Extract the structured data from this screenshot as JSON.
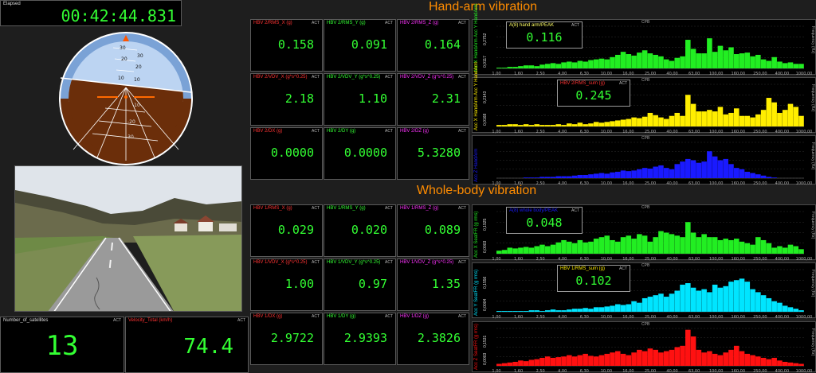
{
  "elapsed": {
    "label": "Elapsed",
    "value": "00:42:44.831"
  },
  "horizon": {
    "pitch_labels": [
      "30",
      "20",
      "10",
      "-10",
      "-20",
      "-30",
      "30",
      "20",
      "10"
    ]
  },
  "satellites": {
    "label": "Number_of_satellites",
    "act": "ACT",
    "value": "13"
  },
  "velocity": {
    "label": "Velocity_Total (km/h)",
    "act": "ACT",
    "value": "74.4"
  },
  "hand_arm": {
    "title": "Hand-arm vibration",
    "cells": [
      {
        "label": "HBV 2/RMS_X (g)",
        "act": "ACT",
        "value": "0.158",
        "color": "#ff3333"
      },
      {
        "label": "HBV 2/RMS_Y (g)",
        "act": "ACT",
        "value": "0.091",
        "color": "#33ff33"
      },
      {
        "label": "HBV 2/RMS_Z (g)",
        "act": "ACT",
        "value": "0.164",
        "color": "#ff33ff"
      },
      {
        "label": "HBV 2/VDV_X (g*s^0.25)",
        "act": "ACT",
        "value": "2.18",
        "color": "#ff3333"
      },
      {
        "label": "HBV 2/VDV_Y (g*s^0.25)",
        "act": "ACT",
        "value": "1.10",
        "color": "#33ff33"
      },
      {
        "label": "HBV 2/VDV_Z (g*s^0.25)",
        "act": "ACT",
        "value": "2.31",
        "color": "#ff33ff"
      },
      {
        "label": "HBV 2/DX (g)",
        "act": "ACT",
        "value": "0.0000",
        "color": "#ff3333"
      },
      {
        "label": "HBV 2/DY (g)",
        "act": "ACT",
        "value": "0.0000",
        "color": "#33ff33"
      },
      {
        "label": "HBV 2/DZ (g)",
        "act": "ACT",
        "value": "5.3280",
        "color": "#ff33ff"
      }
    ]
  },
  "whole_body": {
    "title": "Whole-body vibration",
    "cells": [
      {
        "label": "HBV 1/RMS_X (g)",
        "act": "ACT",
        "value": "0.029",
        "color": "#ff3333"
      },
      {
        "label": "HBV 1/RMS_Y (g)",
        "act": "ACT",
        "value": "0.020",
        "color": "#33ff33"
      },
      {
        "label": "HBV 1/RMS_Z (g)",
        "act": "ACT",
        "value": "0.089",
        "color": "#ff33ff"
      },
      {
        "label": "HBV 1/VDV_X (g*s^0.25)",
        "act": "ACT",
        "value": "1.00",
        "color": "#ff3333"
      },
      {
        "label": "HBV 1/VDV_Y (g*s^0.25)",
        "act": "ACT",
        "value": "0.97",
        "color": "#33ff33"
      },
      {
        "label": "HBV 1/VDV_Z (g*s^0.25)",
        "act": "ACT",
        "value": "1.35",
        "color": "#ff33ff"
      },
      {
        "label": "HBV 1/DX (g)",
        "act": "ACT",
        "value": "2.9722",
        "color": "#ff3333"
      },
      {
        "label": "HBV 1/DY (g)",
        "act": "ACT",
        "value": "2.9393",
        "color": "#33ff33"
      },
      {
        "label": "HBV 1/DZ (g)",
        "act": "ACT",
        "value": "2.3826",
        "color": "#ff33ff"
      }
    ]
  },
  "spectra_common": {
    "cpb_label": "CPB",
    "freq_label": "Frequency (Hz)",
    "ticks": [
      "1,00",
      "1,60",
      "2,50",
      "4,00",
      "6,30",
      "10,00",
      "16,00",
      "25,00",
      "40,00",
      "63,00",
      "100,00",
      "160,00",
      "250,00",
      "400,00",
      "1000,00"
    ]
  },
  "chart_data": [
    {
      "type": "bar",
      "ylabel": "Acc X HandArm Acc Y HandArm",
      "ylim_labels": [
        "0,2752",
        "0,0117"
      ],
      "overlay_label": "A(8) hand arm/PEAK",
      "overlay_value": "0.116",
      "overlay_label_color": "#ffff66",
      "color": "#22ee22",
      "values": [
        1,
        1,
        2,
        2,
        3,
        4,
        4,
        3,
        5,
        6,
        7,
        6,
        8,
        9,
        8,
        10,
        9,
        11,
        12,
        13,
        12,
        15,
        18,
        22,
        19,
        17,
        21,
        24,
        20,
        18,
        16,
        12,
        10,
        14,
        16,
        38,
        26,
        20,
        20,
        40,
        22,
        30,
        24,
        28,
        19,
        20,
        21,
        16,
        18,
        12,
        10,
        15,
        9,
        7,
        8,
        6,
        6
      ]
    },
    {
      "type": "bar",
      "ylabel": "Acc X HandArm Acc Y HandArm",
      "ylim_labels": [
        "0,2143",
        "0,0168"
      ],
      "overlay_label": "HBV 2/RMS_sum (g)",
      "overlay_value": "0.245",
      "overlay_label_color": "#ff3333",
      "color": "#ffee00",
      "values": [
        2,
        2,
        3,
        3,
        2,
        3,
        2,
        3,
        2,
        2,
        2,
        3,
        2,
        4,
        3,
        5,
        3,
        4,
        6,
        5,
        6,
        7,
        8,
        9,
        10,
        12,
        11,
        13,
        18,
        15,
        12,
        10,
        14,
        18,
        14,
        42,
        30,
        20,
        20,
        22,
        20,
        26,
        16,
        18,
        24,
        14,
        14,
        12,
        16,
        22,
        38,
        32,
        18,
        22,
        30,
        26,
        14
      ]
    },
    {
      "type": "bar",
      "ylabel": "Acc Z HandArm",
      "ylim_labels": [],
      "overlay_label": "",
      "overlay_value": "",
      "overlay_label_color": "#ffffff",
      "color": "#1a1aff",
      "values": [
        0,
        0,
        0,
        0,
        0,
        1,
        1,
        1,
        2,
        2,
        2,
        3,
        3,
        3,
        4,
        5,
        5,
        6,
        7,
        8,
        7,
        9,
        10,
        12,
        11,
        12,
        14,
        16,
        15,
        18,
        20,
        16,
        14,
        22,
        26,
        30,
        28,
        24,
        26,
        42,
        34,
        28,
        30,
        22,
        16,
        14,
        10,
        8,
        6,
        4,
        2,
        1,
        0,
        0,
        0,
        0,
        0
      ]
    },
    {
      "type": "bar",
      "ylabel": "Acc X SeatFR (g rms)",
      "ylim_labels": [
        "0,1925",
        "0,0003"
      ],
      "overlay_label": "A(8) whole body/PEAK",
      "overlay_value": "0.048",
      "overlay_label_color": "#1a1aff",
      "color": "#22ee22",
      "values": [
        4,
        5,
        8,
        7,
        8,
        9,
        8,
        10,
        12,
        10,
        12,
        15,
        18,
        16,
        14,
        18,
        15,
        16,
        20,
        22,
        24,
        18,
        16,
        22,
        24,
        20,
        26,
        24,
        16,
        22,
        30,
        28,
        26,
        24,
        22,
        42,
        28,
        22,
        26,
        22,
        22,
        18,
        20,
        18,
        20,
        16,
        14,
        12,
        22,
        18,
        14,
        8,
        10,
        8,
        12,
        10,
        6
      ]
    },
    {
      "type": "bar",
      "ylabel": "Acc Y SeatFR (g rms)",
      "ylim_labels": [
        "0,1556",
        "0,0004"
      ],
      "overlay_label": "HBV 1/RMS_sum (g)",
      "overlay_value": "0.102",
      "overlay_label_color": "#ffee00",
      "color": "#00e5ff",
      "values": [
        1,
        1,
        1,
        1,
        1,
        1,
        2,
        2,
        1,
        2,
        3,
        2,
        2,
        3,
        4,
        4,
        5,
        4,
        6,
        6,
        7,
        8,
        10,
        9,
        10,
        14,
        12,
        18,
        20,
        22,
        24,
        20,
        24,
        28,
        36,
        38,
        32,
        28,
        30,
        26,
        36,
        32,
        34,
        40,
        42,
        44,
        40,
        30,
        26,
        22,
        18,
        14,
        12,
        8,
        6,
        4,
        2
      ]
    },
    {
      "type": "bar",
      "ylabel": "Acc Z SeatFR (g rms)",
      "ylim_labels": [
        "0,1531",
        "0,0003"
      ],
      "overlay_label": "",
      "overlay_value": "",
      "overlay_label_color": "#ffffff",
      "color": "#ff1111",
      "values": [
        3,
        4,
        5,
        6,
        8,
        7,
        9,
        10,
        12,
        14,
        12,
        13,
        14,
        16,
        14,
        16,
        18,
        15,
        14,
        16,
        18,
        20,
        22,
        18,
        16,
        20,
        24,
        22,
        26,
        24,
        20,
        22,
        24,
        28,
        30,
        54,
        44,
        24,
        20,
        22,
        18,
        16,
        20,
        24,
        30,
        22,
        18,
        16,
        14,
        12,
        10,
        12,
        8,
        6,
        5,
        4,
        3
      ]
    }
  ]
}
